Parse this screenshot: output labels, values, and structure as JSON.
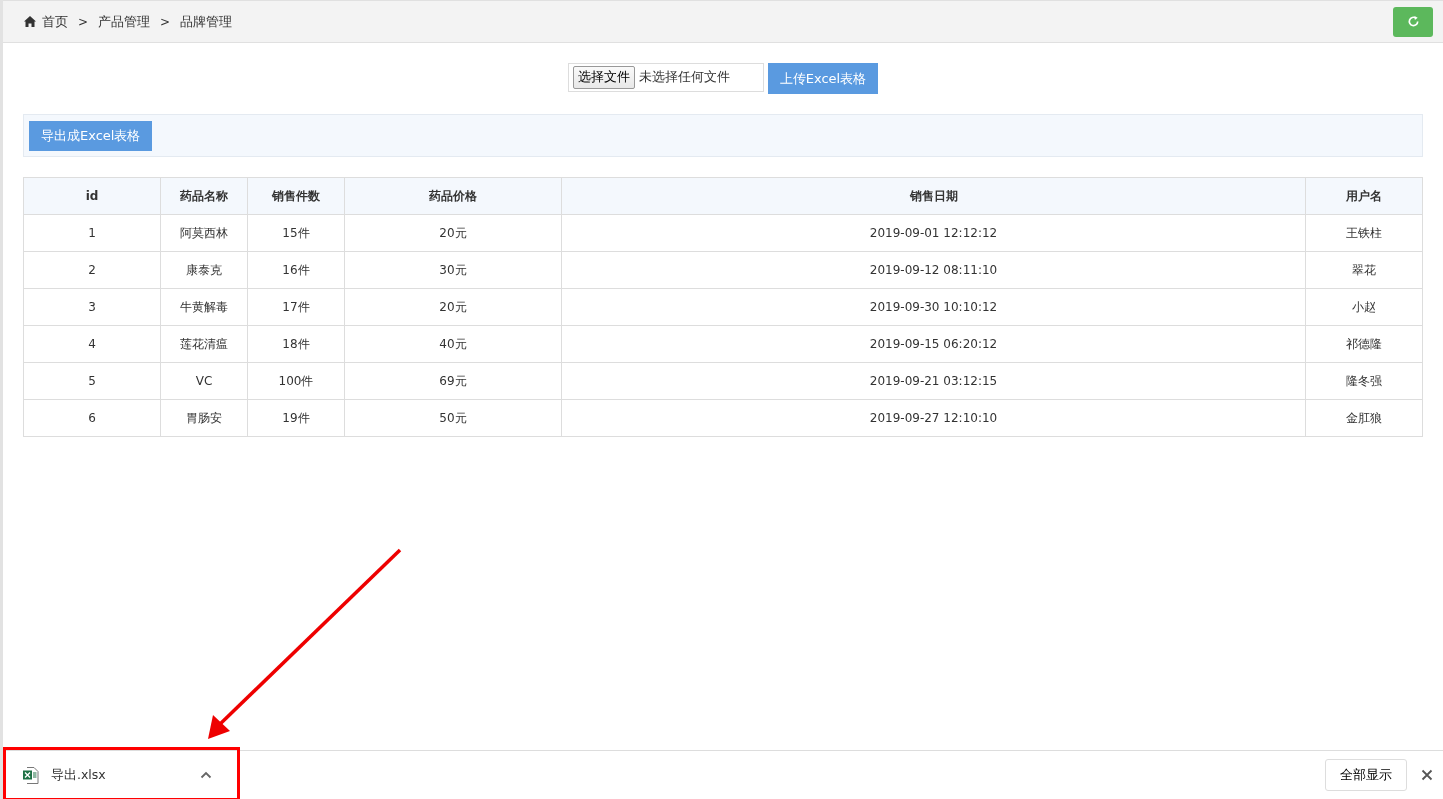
{
  "breadcrumb": [
    {
      "label": "首页"
    },
    {
      "label": "产品管理",
      "separator": ">"
    },
    {
      "label": "品牌管理",
      "separator": ">"
    }
  ],
  "upload": {
    "choose_button": "选择文件",
    "file_status": "未选择任何文件",
    "upload_button": "上传Excel表格"
  },
  "export_button": "导出成Excel表格",
  "table": {
    "columns": [
      "id",
      "药品名称",
      "销售件数",
      "药品价格",
      "销售日期",
      "用户名"
    ],
    "rows": [
      [
        "1",
        "阿莫西林",
        "15件",
        "20元",
        "2019-09-01 12:12:12",
        "王铁柱"
      ],
      [
        "2",
        "康泰克",
        "16件",
        "30元",
        "2019-09-12 08:11:10",
        "翠花"
      ],
      [
        "3",
        "牛黄解毒",
        "17件",
        "20元",
        "2019-09-30 10:10:12",
        "小赵"
      ],
      [
        "4",
        "莲花清瘟",
        "18件",
        "40元",
        "2019-09-15 06:20:12",
        "祁德隆"
      ],
      [
        "5",
        "VC",
        "100件",
        "69元",
        "2019-09-21 03:12:15",
        "隆冬强"
      ],
      [
        "6",
        "胃肠安",
        "19件",
        "50元",
        "2019-09-27 12:10:10",
        "金肛狼"
      ]
    ]
  },
  "download_bar": {
    "file_name": "导出.xlsx",
    "show_all_button": "全部显示"
  }
}
